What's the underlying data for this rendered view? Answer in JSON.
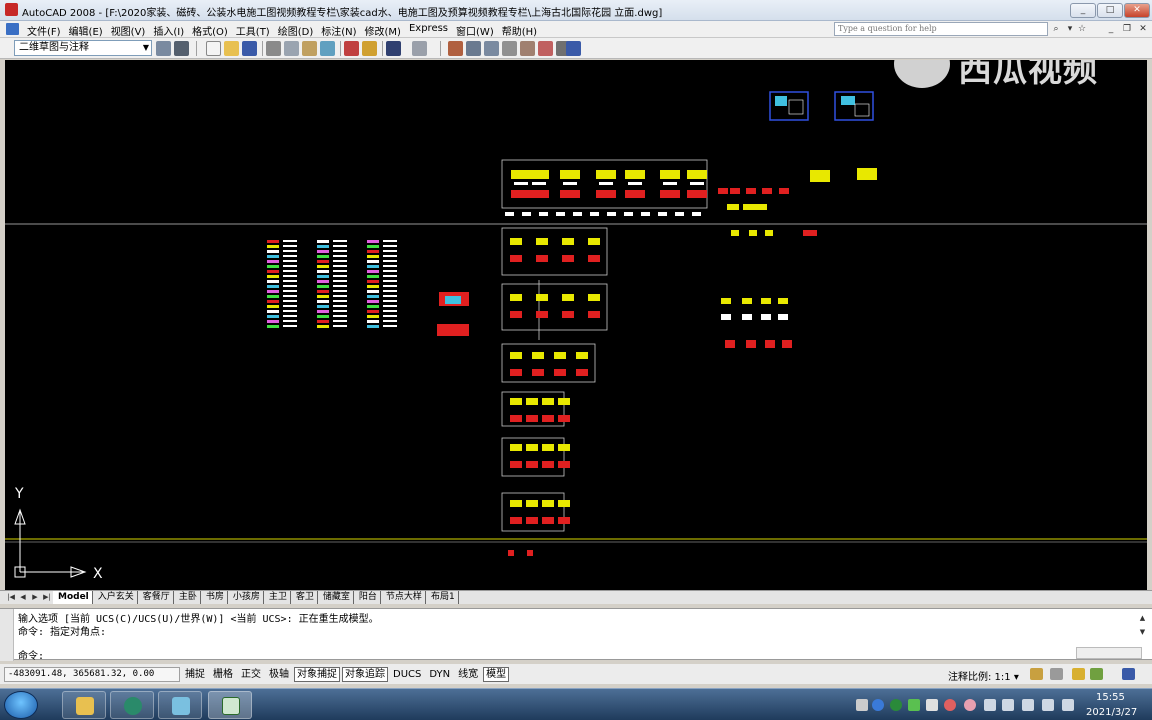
{
  "window": {
    "title": "AutoCAD 2008 - [F:\\2020家装、磁砖、公装水电施工图视频教程专栏\\家装cad水、电施工图及预算视频教程专栏\\上海古北国际花园 立面.dwg]",
    "minimize": "_",
    "maximize": "□",
    "close": "✕"
  },
  "menu": {
    "items": [
      "文件(F)",
      "编辑(E)",
      "视图(V)",
      "插入(I)",
      "格式(O)",
      "工具(T)",
      "绘图(D)",
      "标注(N)",
      "修改(M)",
      "Express",
      "窗口(W)",
      "帮助(H)"
    ],
    "help_placeholder": "Type a question for help"
  },
  "toolbar": {
    "workspace": "二维草图与注释",
    "dropdown_arrow": "▼"
  },
  "watermark": {
    "text": "西瓜视频"
  },
  "ucs": {
    "x_label": "X",
    "y_label": "Y"
  },
  "layout_tabs": {
    "nav": [
      "|◀",
      "◀",
      "▶",
      "▶|"
    ],
    "tabs": [
      "Model",
      "入户玄关",
      "客餐厅",
      "主卧",
      "书房",
      "小孩房",
      "主卫",
      "客卫",
      "储藏室",
      "阳台",
      "节点大样",
      "布局1"
    ],
    "active": "Model"
  },
  "command": {
    "lines": [
      "输入选项 [当前 UCS(C)/UCS(U)/世界(W)] <当前 UCS>:  正在重生成模型。",
      "命令: 指定对角点:"
    ],
    "prompt": "命令:",
    "scroll_up": "▲",
    "scroll_down": "▼"
  },
  "status": {
    "coordinates": "-483091.48, 365681.32, 0.00",
    "toggles": [
      {
        "label": "捕捉",
        "on": false
      },
      {
        "label": "栅格",
        "on": false
      },
      {
        "label": "正交",
        "on": false
      },
      {
        "label": "极轴",
        "on": false
      },
      {
        "label": "对象捕捉",
        "on": true
      },
      {
        "label": "对象追踪",
        "on": true
      },
      {
        "label": "DUCS",
        "on": false
      },
      {
        "label": "DYN",
        "on": false
      },
      {
        "label": "线宽",
        "on": false
      },
      {
        "label": "模型",
        "on": true
      }
    ],
    "annotation_scale": "注释比例: 1:1 ▾"
  },
  "taskbar": {
    "time": "15:55",
    "date": "2021/3/27"
  },
  "colors": {
    "canvas": "#000000",
    "crosshair": "#c8c8c8",
    "yellow_line": "#d8d800",
    "frame": "#c8c8c8",
    "red": "#e02020",
    "yellow": "#e8e800",
    "white": "#ffffff",
    "cyan": "#40c0e0",
    "blue": "#3050e0"
  }
}
